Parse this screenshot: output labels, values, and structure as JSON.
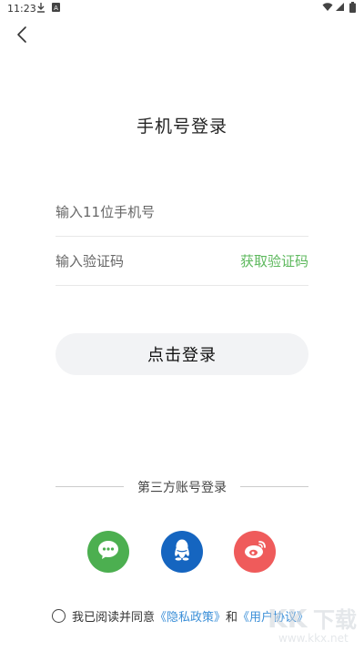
{
  "status_bar": {
    "time": "11:23",
    "icons": [
      "download-icon",
      "notification-icon",
      "wifi-icon",
      "signal-icon",
      "battery-icon"
    ]
  },
  "back_icon": "chevron-left-icon",
  "title": "手机号登录",
  "phone_field": {
    "placeholder": "输入11位手机号",
    "value": ""
  },
  "code_field": {
    "placeholder": "输入验证码",
    "value": "",
    "get_code_label": "获取验证码"
  },
  "login_button_label": "点击登录",
  "third_party": {
    "label": "第三方账号登录",
    "options": [
      {
        "name": "wechat",
        "icon": "wechat-icon",
        "color": "#4caf50"
      },
      {
        "name": "qq",
        "icon": "qq-icon",
        "color": "#1565c0"
      },
      {
        "name": "weibo",
        "icon": "weibo-icon",
        "color": "#ef5b5b"
      }
    ]
  },
  "agreement": {
    "prefix": "我已阅读并同意",
    "privacy": "《隐私政策》",
    "and": "和",
    "user": "《用户协议》",
    "checked": false
  },
  "colors": {
    "accent_green": "#5cb85c",
    "link_blue": "#3b8fd8",
    "button_bg": "#f2f3f5"
  }
}
